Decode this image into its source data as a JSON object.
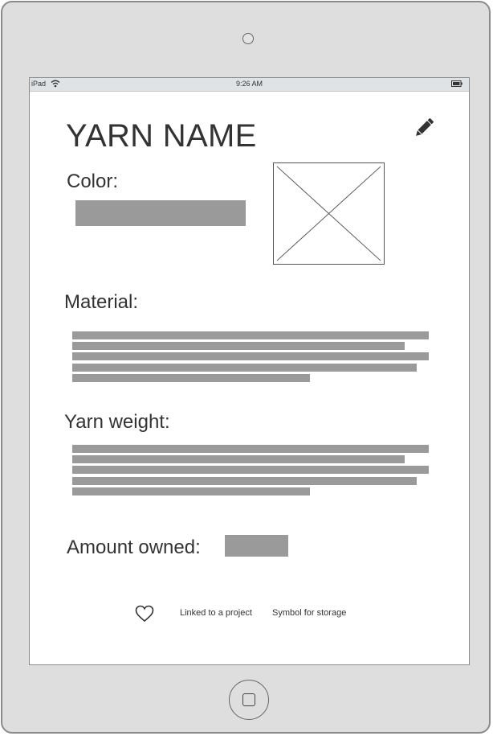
{
  "status_bar": {
    "device": "iPad",
    "time": "9:26 AM",
    "wifi_icon": "wifi-icon",
    "battery_icon": "battery-icon"
  },
  "yarn": {
    "title": "YARN NAME",
    "edit_icon": "pencil-icon",
    "color_label": "Color:",
    "material_label": "Material:",
    "weight_label": "Yarn weight:",
    "amount_label": "Amount owned:"
  },
  "footer": {
    "heart_icon": "heart-icon",
    "linked_label": "Linked to a project",
    "storage_label": "Symbol for storage"
  },
  "colors": {
    "device_frame": "#dedede",
    "placeholder_gray": "#9a9a9a",
    "text": "#333333",
    "status_bar": "#dfe3e6"
  }
}
